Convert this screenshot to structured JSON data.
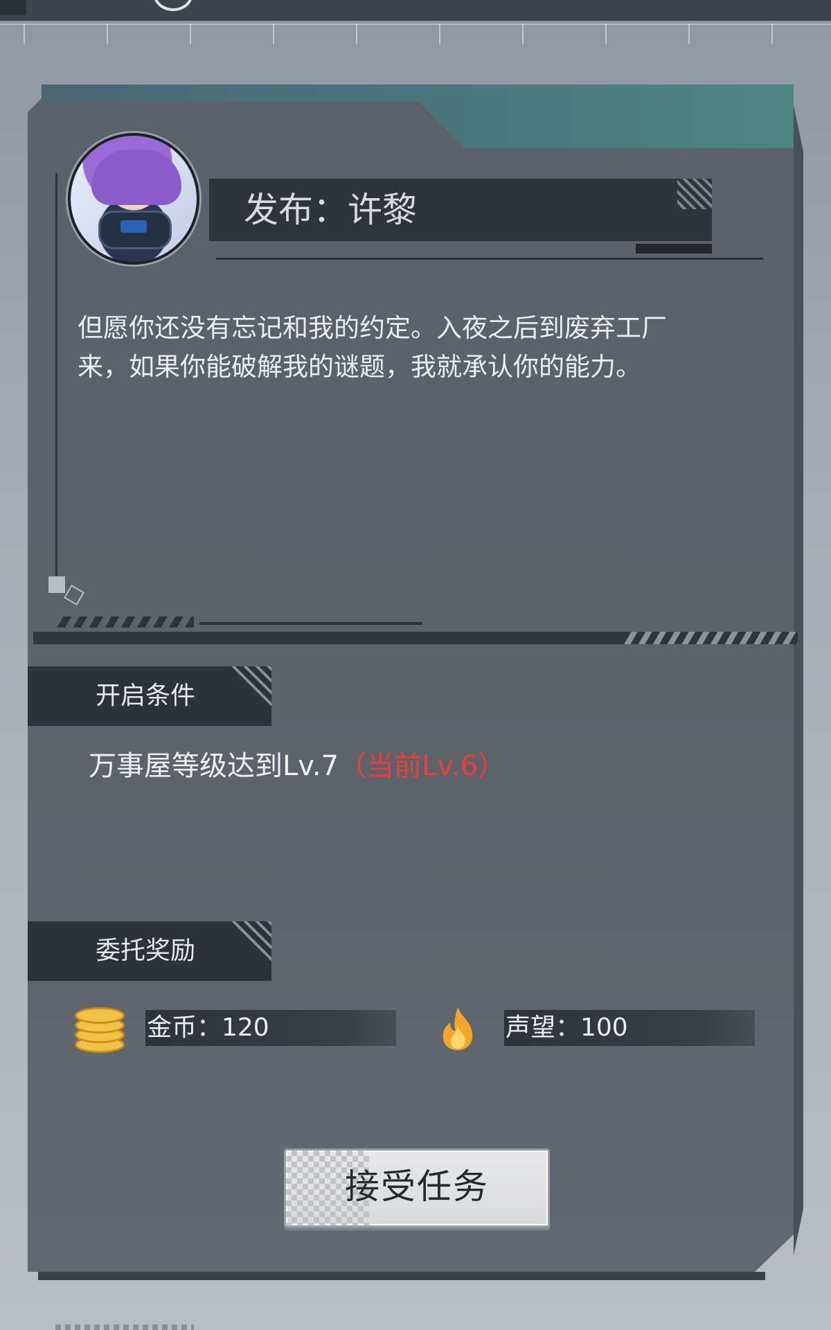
{
  "colors": {
    "panel": "#5d6269",
    "header_teal": "#4a7880",
    "dark_bar": "#2d3238",
    "warning_red": "#e8413d",
    "text_light": "#eceff1",
    "coin_gold": "#f1c247",
    "fire_orange": "#f3a62a"
  },
  "publisher": {
    "title": "发布：许黎",
    "avatar": "character-avatar"
  },
  "description": {
    "line1": "但愿你还没有忘记和我的约定。入夜之后到废弃工厂",
    "line2": "来，如果你能破解我的谜题，我就承认你的能力。"
  },
  "condition": {
    "header": "开启条件",
    "requirement": "万事屋等级达到Lv.7",
    "current": "（当前Lv.6）"
  },
  "reward": {
    "header": "委托奖励",
    "items": [
      {
        "icon": "coins-icon",
        "label": "金币：120"
      },
      {
        "icon": "fire-icon",
        "label": "声望：100"
      }
    ]
  },
  "actions": {
    "accept_label": "接受任务"
  }
}
